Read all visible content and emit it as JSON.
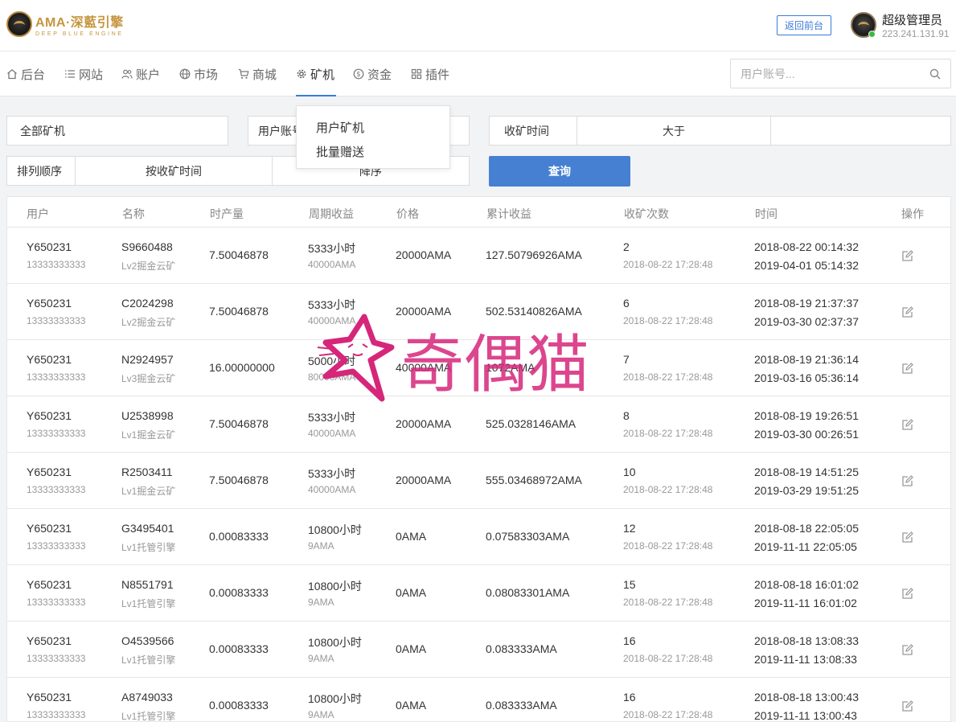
{
  "brand": {
    "title": "AMA·深藍引擎",
    "subtitle": "DEEP BLUE ENGINE"
  },
  "header": {
    "back_label": "返回前台",
    "admin_name": "超级管理员",
    "admin_ip": "223.241.131.91"
  },
  "nav": {
    "items": [
      {
        "label": "后台",
        "icon": "home-icon"
      },
      {
        "label": "网站",
        "icon": "list-icon"
      },
      {
        "label": "账户",
        "icon": "users-icon"
      },
      {
        "label": "市场",
        "icon": "globe-icon"
      },
      {
        "label": "商城",
        "icon": "cart-icon"
      },
      {
        "label": "矿机",
        "icon": "gear-icon",
        "active": true
      },
      {
        "label": "资金",
        "icon": "dollar-icon"
      },
      {
        "label": "插件",
        "icon": "grid-icon"
      }
    ],
    "search_placeholder": "用户账号..."
  },
  "dropdown": {
    "items": [
      "用户矿机",
      "批量赠送"
    ]
  },
  "filters": {
    "all_miners": "全部矿机",
    "user_account_label": "用户账号",
    "harvest_time_label": "收矿时间",
    "compare_op": "大于",
    "sort_label": "排列顺序",
    "sort_field": "按收矿时间",
    "sort_dir": "降序",
    "query_label": "查询"
  },
  "table": {
    "headers": [
      "用户",
      "名称",
      "时产量",
      "周期收益",
      "价格",
      "累计收益",
      "收矿次数",
      "时间",
      "操作"
    ],
    "rows": [
      {
        "user": "Y650231",
        "phone": "13333333333",
        "id": "S9660488",
        "level": "Lv2掘金云矿",
        "rate": "7.50046878",
        "cycle": "5333小时",
        "cycle_sub": "40000AMA",
        "price": "20000AMA",
        "total": "127.50796926AMA",
        "count": "2",
        "count_time": "2018-08-22 17:28:48",
        "start": "2018-08-22 00:14:32",
        "end": "2019-04-01 05:14:32"
      },
      {
        "user": "Y650231",
        "phone": "13333333333",
        "id": "C2024298",
        "level": "Lv2掘金云矿",
        "rate": "7.50046878",
        "cycle": "5333小时",
        "cycle_sub": "40000AMA",
        "price": "20000AMA",
        "total": "502.53140826AMA",
        "count": "6",
        "count_time": "2018-08-22 17:28:48",
        "start": "2018-08-19 21:37:37",
        "end": "2019-03-30 02:37:37"
      },
      {
        "user": "Y650231",
        "phone": "13333333333",
        "id": "N2924957",
        "level": "Lv3掘金云矿",
        "rate": "16.00000000",
        "cycle": "5000小时",
        "cycle_sub": "80000AMA",
        "price": "40000AMA",
        "total": "1072AMA",
        "count": "7",
        "count_time": "2018-08-22 17:28:48",
        "start": "2018-08-19 21:36:14",
        "end": "2019-03-16 05:36:14"
      },
      {
        "user": "Y650231",
        "phone": "13333333333",
        "id": "U2538998",
        "level": "Lv1掘金云矿",
        "rate": "7.50046878",
        "cycle": "5333小时",
        "cycle_sub": "40000AMA",
        "price": "20000AMA",
        "total": "525.0328146AMA",
        "count": "8",
        "count_time": "2018-08-22 17:28:48",
        "start": "2018-08-19 19:26:51",
        "end": "2019-03-30 00:26:51"
      },
      {
        "user": "Y650231",
        "phone": "13333333333",
        "id": "R2503411",
        "level": "Lv1掘金云矿",
        "rate": "7.50046878",
        "cycle": "5333小时",
        "cycle_sub": "40000AMA",
        "price": "20000AMA",
        "total": "555.03468972AMA",
        "count": "10",
        "count_time": "2018-08-22 17:28:48",
        "start": "2018-08-19 14:51:25",
        "end": "2019-03-29 19:51:25"
      },
      {
        "user": "Y650231",
        "phone": "13333333333",
        "id": "G3495401",
        "level": "Lv1托管引擎",
        "rate": "0.00083333",
        "cycle": "10800小时",
        "cycle_sub": "9AMA",
        "price": "0AMA",
        "total": "0.07583303AMA",
        "count": "12",
        "count_time": "2018-08-22 17:28:48",
        "start": "2018-08-18 22:05:05",
        "end": "2019-11-11 22:05:05"
      },
      {
        "user": "Y650231",
        "phone": "13333333333",
        "id": "N8551791",
        "level": "Lv1托管引擎",
        "rate": "0.00083333",
        "cycle": "10800小时",
        "cycle_sub": "9AMA",
        "price": "0AMA",
        "total": "0.08083301AMA",
        "count": "15",
        "count_time": "2018-08-22 17:28:48",
        "start": "2018-08-18 16:01:02",
        "end": "2019-11-11 16:01:02"
      },
      {
        "user": "Y650231",
        "phone": "13333333333",
        "id": "O4539566",
        "level": "Lv1托管引擎",
        "rate": "0.00083333",
        "cycle": "10800小时",
        "cycle_sub": "9AMA",
        "price": "0AMA",
        "total": "0.083333AMA",
        "count": "16",
        "count_time": "2018-08-22 17:28:48",
        "start": "2018-08-18 13:08:33",
        "end": "2019-11-11 13:08:33"
      },
      {
        "user": "Y650231",
        "phone": "13333333333",
        "id": "A8749033",
        "level": "Lv1托管引擎",
        "rate": "0.00083333",
        "cycle": "10800小时",
        "cycle_sub": "9AMA",
        "price": "0AMA",
        "total": "0.083333AMA",
        "count": "16",
        "count_time": "2018-08-22 17:28:48",
        "start": "2018-08-18 13:00:43",
        "end": "2019-11-11 13:00:43"
      }
    ]
  },
  "watermark": {
    "text": "奇偶猫",
    "color": "#d6267a"
  },
  "colors": {
    "accent": "#3b7bd8",
    "button": "#4680d2",
    "gold": "#c5953f",
    "online": "#3cba3c"
  }
}
